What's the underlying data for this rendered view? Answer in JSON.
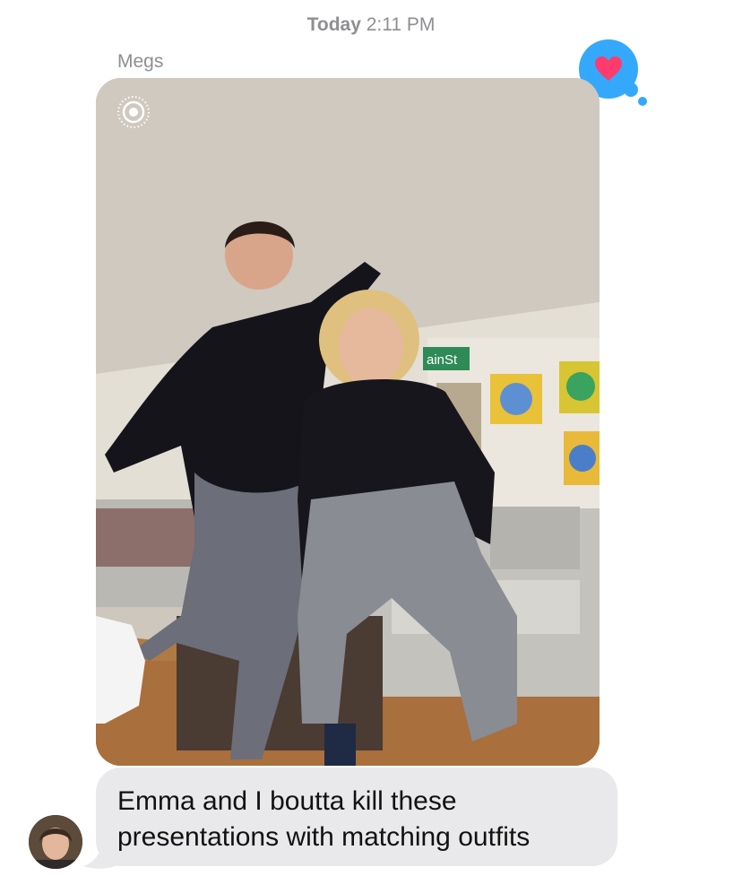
{
  "thread": {
    "timestamp_day": "Today",
    "timestamp_time": "2:11 PM",
    "sender_name": "Megs"
  },
  "reaction": {
    "icon": "heart-icon",
    "color": "#34a9fb",
    "heart_color": "#ff3b6e"
  },
  "photo_message": {
    "live_photo_icon": "live-photo-icon",
    "scene_sign_text": "ainSt"
  },
  "text_message": {
    "line1": "Emma and I boutta kill these",
    "line2": "presentations with matching outfits",
    "bubble_color": "#e9e9eb"
  },
  "avatar": {
    "icon": "avatar"
  }
}
